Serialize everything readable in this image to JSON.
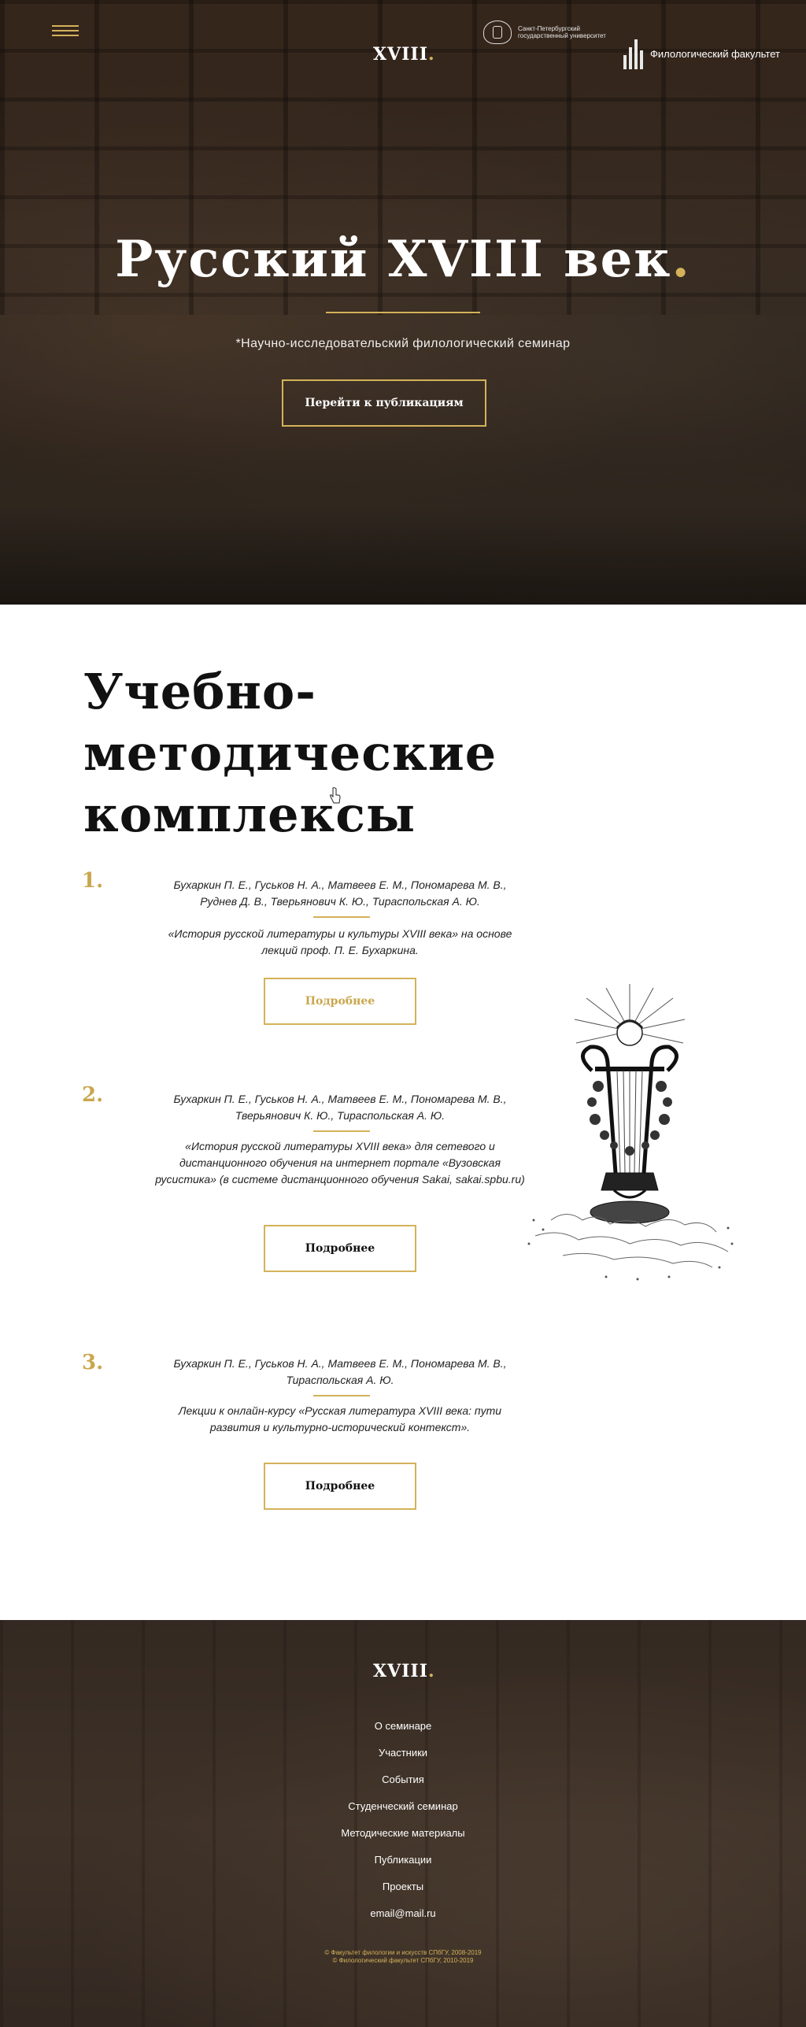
{
  "header": {
    "menu_icon": "hamburger-icon",
    "logo": "XVIII",
    "logo_dot": ".",
    "university": "Санкт-Петербургский государственный университет",
    "faculty": "Филологический факультет"
  },
  "hero": {
    "title": "Русский XVIII век",
    "title_dot": ".",
    "subtitle": "*Научно-исследовательский филологический семинар",
    "button": "Перейти к публикациям"
  },
  "main": {
    "section_title": "Учебно-методические комплексы",
    "items": [
      {
        "number": "1.",
        "authors": "Бухаркин П. Е., Гуськов Н. А., Матвеев Е. М., Пономарева М. В., Руднев Д. В., Тверьянович К. Ю., Тираспольская А. Ю.",
        "description": "«История русской литературы и культуры XVIII века» на основе лекций проф. П. Е. Бухаркина.",
        "button": "Подробнее"
      },
      {
        "number": "2.",
        "authors": "Бухаркин П. Е., Гуськов Н. А., Матвеев Е. М., Пономарева М. В., Тверьянович К. Ю., Тираспольская А. Ю.",
        "description": "«История русской литературы XVIII века» для сетевого и дистанционного обучения на интернет портале «Вузовская русистика» (в системе дистанционного обучения Sakai, sakai.spbu.ru)",
        "button": "Подробнее"
      },
      {
        "number": "3.",
        "authors": "Бухаркин П. Е., Гуськов Н. А., Матвеев Е. М., Пономарева М. В., Тираспольская А. Ю.",
        "description": "Лекции к онлайн-курсу «Русская литература XVIII века: пути развития и культурно-исторический контекст».",
        "button": "Подробнее"
      }
    ]
  },
  "footer": {
    "logo": "XVIII",
    "logo_dot": ".",
    "nav": [
      "О семинаре",
      "Участники",
      "События",
      "Студенческий семинар",
      "Методические материалы",
      "Публикации",
      "Проекты",
      "email@mail.ru"
    ],
    "copyright_1": "© Факультет филологии и искусств СПбГУ, 2008-2019",
    "copyright_2": "© Филологический факультет СПбГУ, 2010-2019"
  },
  "colors": {
    "accent": "#d4b25a",
    "text": "#111111"
  }
}
